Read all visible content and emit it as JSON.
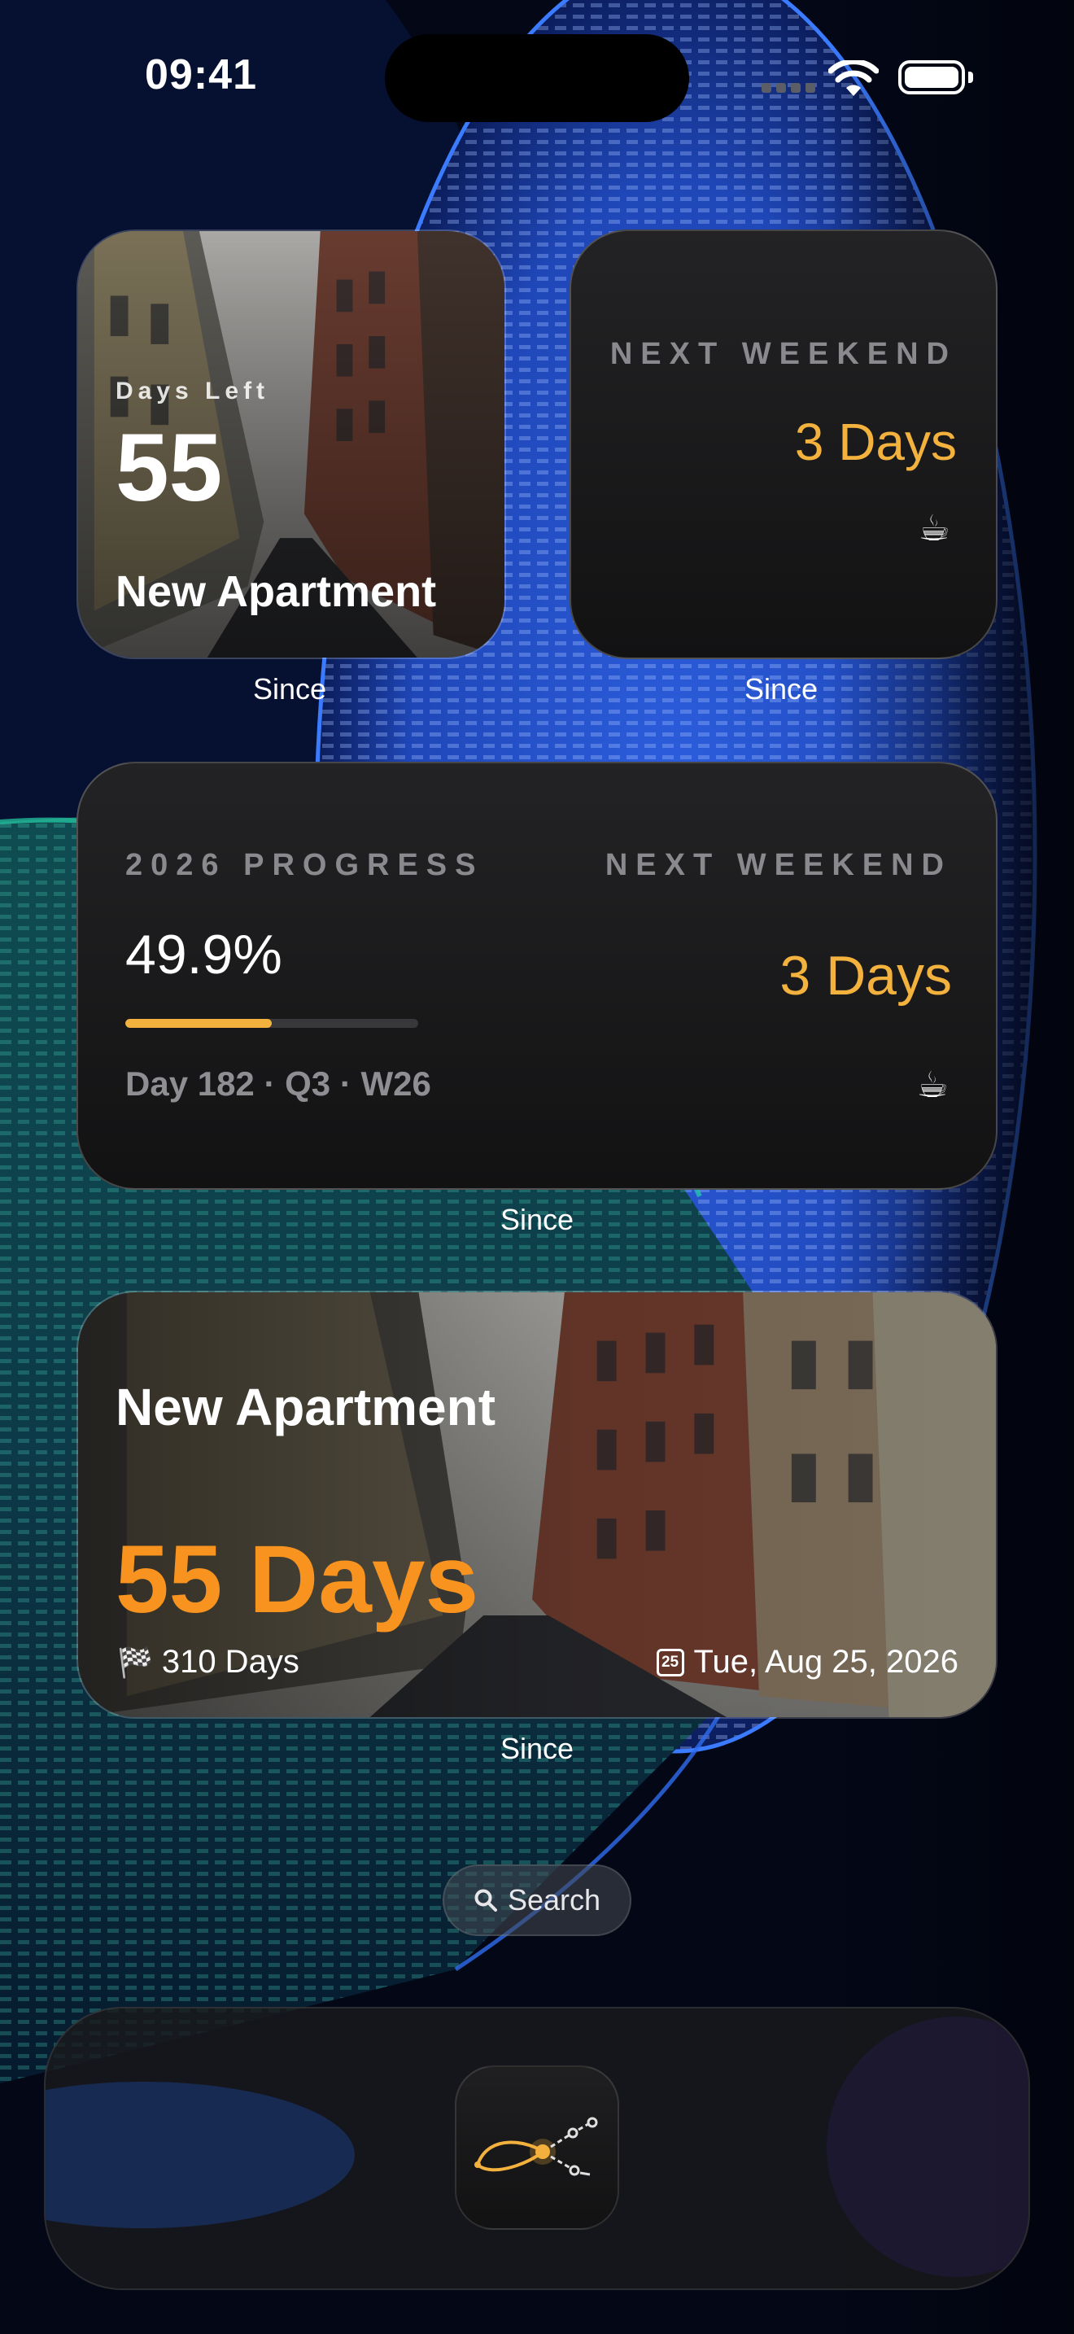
{
  "status_bar": {
    "time": "09:41"
  },
  "widgets": {
    "small_countdown": {
      "label": "Days Left",
      "number": "55",
      "title": "New Apartment",
      "caption": "Since"
    },
    "small_weekend": {
      "label": "NEXT WEEKEND",
      "value": "3 Days",
      "icon": "☕",
      "caption": "Since"
    },
    "medium": {
      "progress_label": "2026 PROGRESS",
      "progress_value": "49.9%",
      "progress_fraction": 0.499,
      "progress_detail": "Day 182 · Q3 · W26",
      "weekend_label": "NEXT WEEKEND",
      "weekend_value": "3 Days",
      "icon": "☕",
      "caption": "Since"
    },
    "large": {
      "title": "New Apartment",
      "days": "55 Days",
      "total": "310 Days",
      "total_icon": "🏁",
      "date": "Tue, Aug 25, 2026",
      "date_icon": "25",
      "caption": "Since"
    }
  },
  "search": {
    "label": "Search"
  },
  "colors": {
    "amber": "#f3b13d",
    "orange": "#f7931e",
    "wallpaper_blue": "#2c5fd9",
    "wallpaper_teal": "#1f8c7c"
  },
  "dock": {
    "app_icon": "since-app-icon"
  }
}
